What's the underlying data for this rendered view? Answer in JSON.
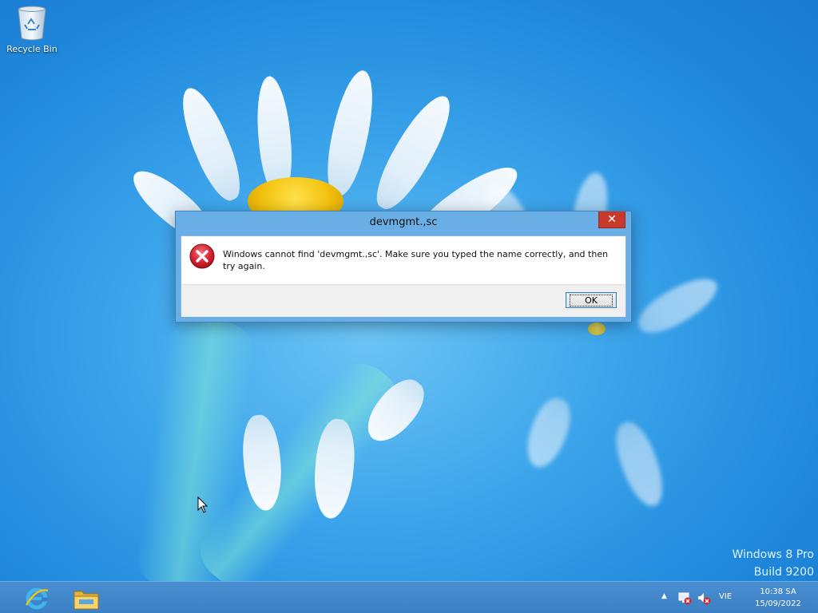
{
  "desktop": {
    "icons": [
      {
        "label": "Recycle Bin",
        "icon": "recycle-bin-icon"
      }
    ],
    "watermark": {
      "line1": "Windows 8 Pro",
      "line2": "Build 9200"
    }
  },
  "dialog": {
    "title": "devmgmt.,sc",
    "close_label": "✕",
    "icon": "error-icon",
    "message": "Windows cannot find 'devmgmt.,sc'. Make sure you typed the name correctly, and then try again.",
    "ok_label": "OK"
  },
  "taskbar": {
    "pinned": [
      {
        "name": "Internet Explorer",
        "icon": "internet-explorer-icon"
      },
      {
        "name": "File Explorer",
        "icon": "file-explorer-icon"
      }
    ],
    "tray": {
      "overflow_icon": "chevron-up-icon",
      "network_icon": "network-disconnected-icon",
      "volume_icon": "volume-muted-icon",
      "language": "VIE",
      "time": "10:38 SA",
      "date": "15/09/2022"
    }
  },
  "colors": {
    "desktop_bg": "#2a93e2",
    "taskbar_bg": "#3f84c8",
    "dialog_frame": "#6aaee6",
    "close_button": "#c7392a"
  }
}
